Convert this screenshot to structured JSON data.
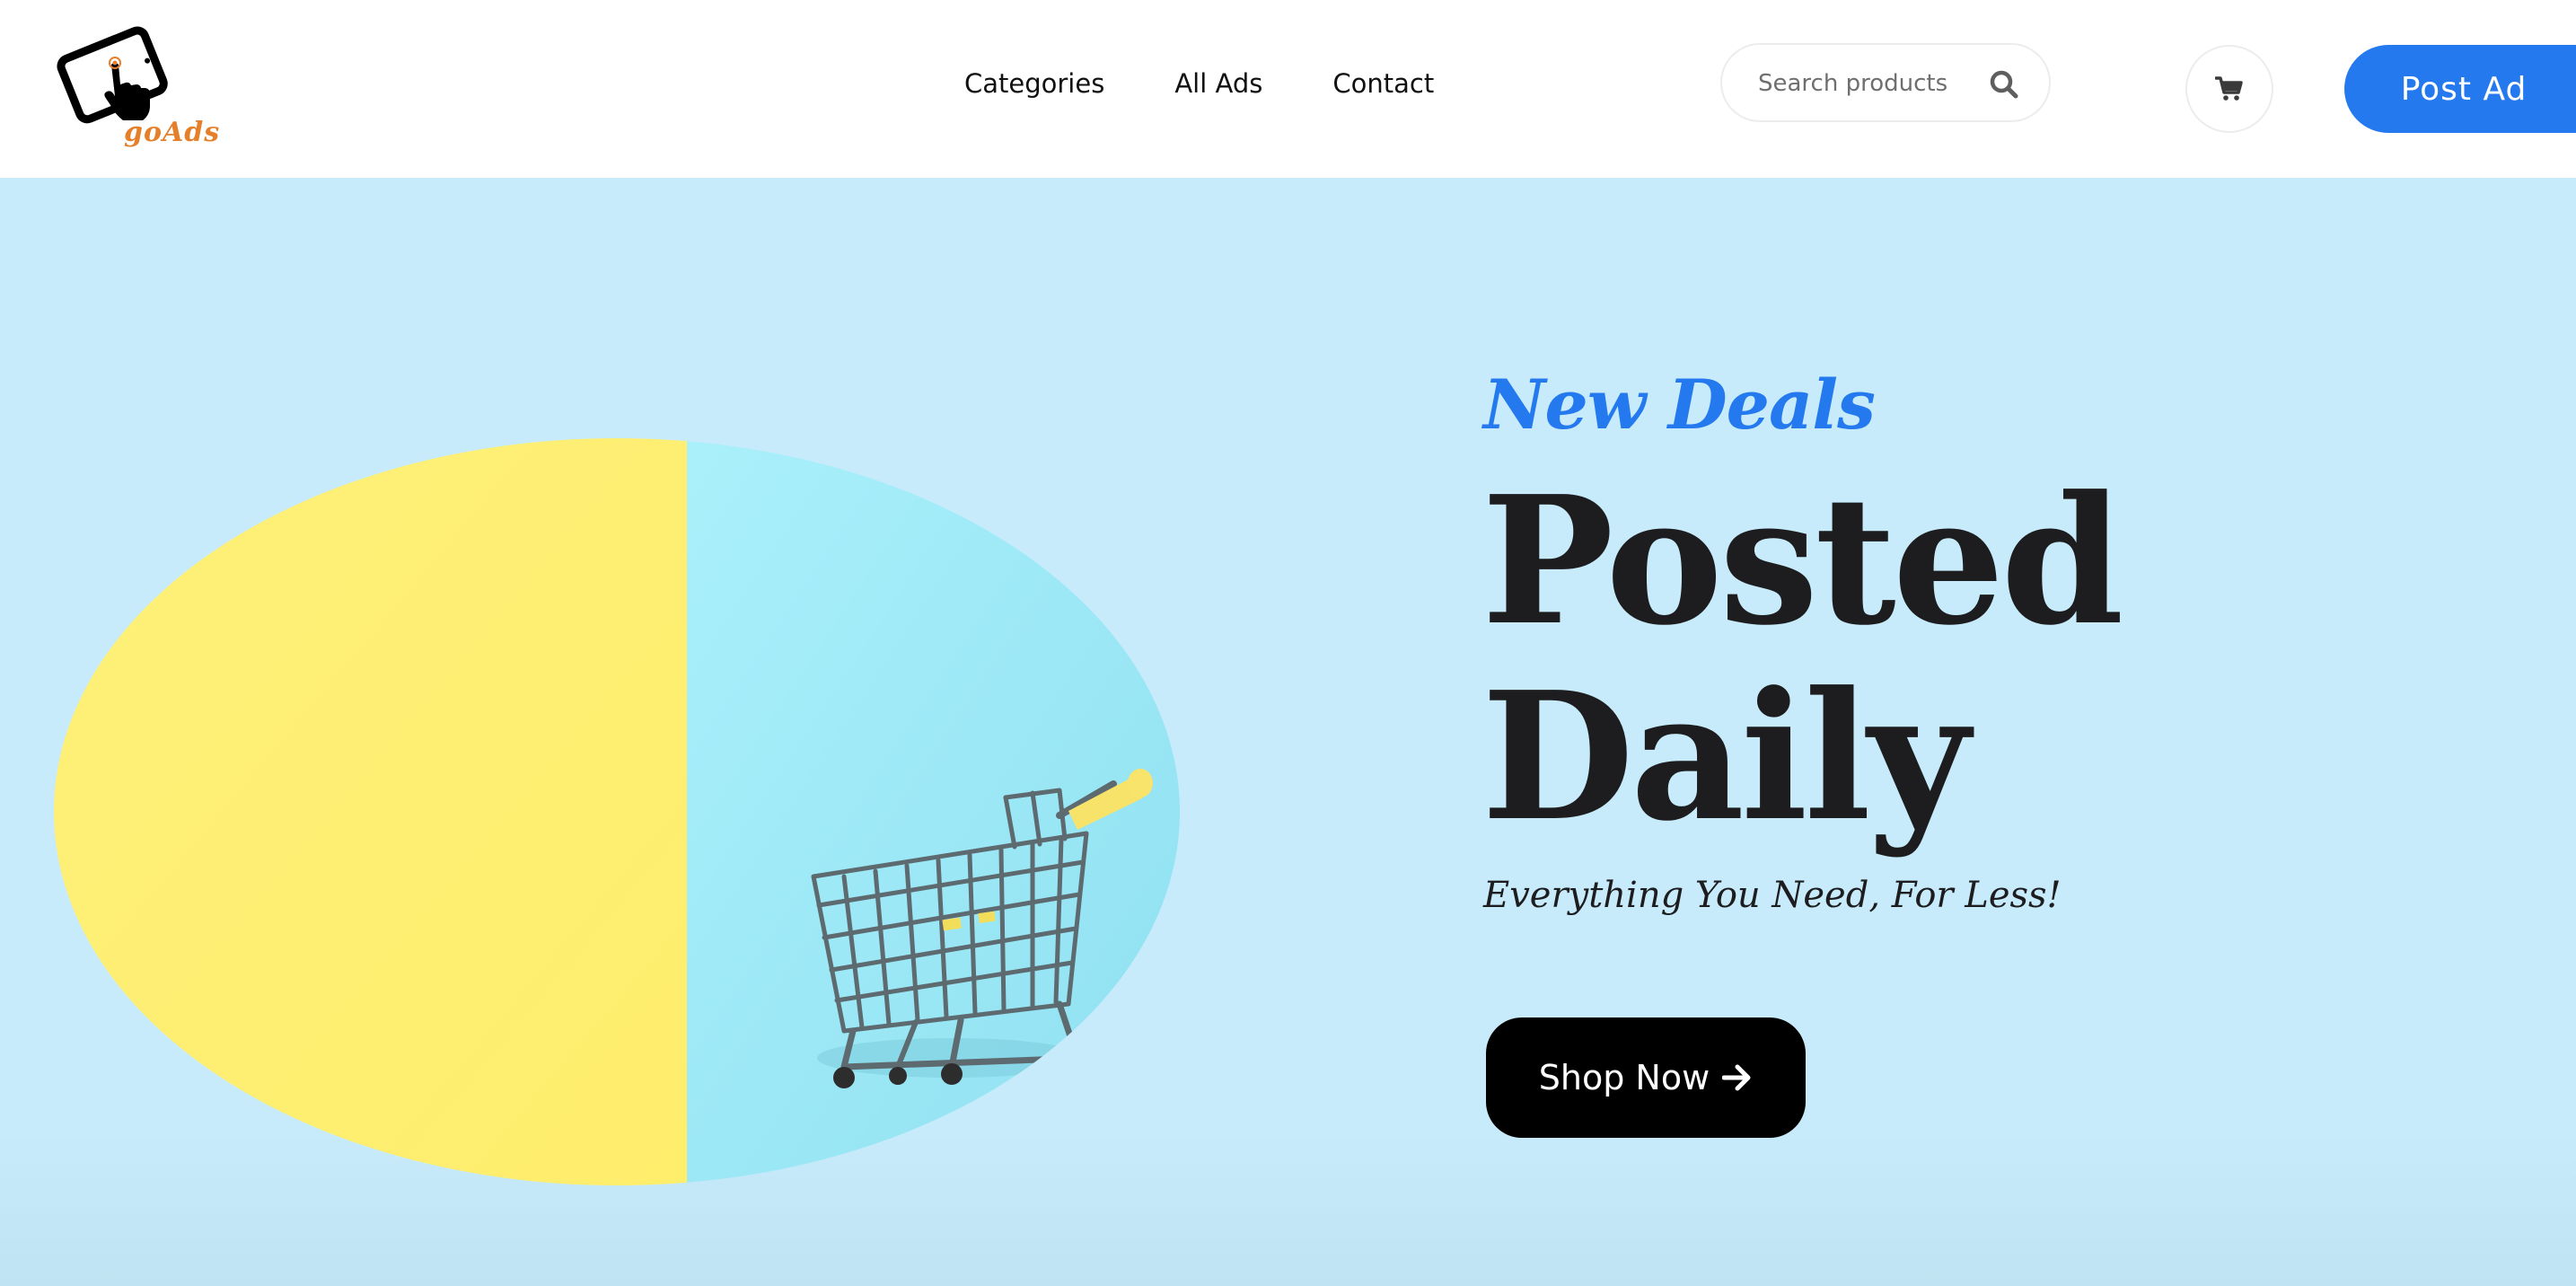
{
  "header": {
    "logo_text": "goAds",
    "nav": [
      {
        "label": "Categories"
      },
      {
        "label": "All Ads"
      },
      {
        "label": "Contact"
      }
    ],
    "search": {
      "placeholder": "Search products",
      "icon": "search-icon"
    },
    "cart_icon": "cart-icon",
    "post_ad_label": "Post Ad"
  },
  "hero": {
    "eyebrow": "New Deals",
    "headline_line1": "Posted",
    "headline_line2": "Daily",
    "tagline": "Everything You Need, For Less!",
    "cta_label": "Shop Now",
    "cta_icon": "arrow-right-icon",
    "image_description_icon": "shopping-cart-icon"
  },
  "colors": {
    "brand_blue": "#2479ef",
    "hero_background": "#c7ebfb",
    "logo_orange": "#e57f2a",
    "yellow": "#fef173",
    "cyan": "#a6ecf7"
  }
}
